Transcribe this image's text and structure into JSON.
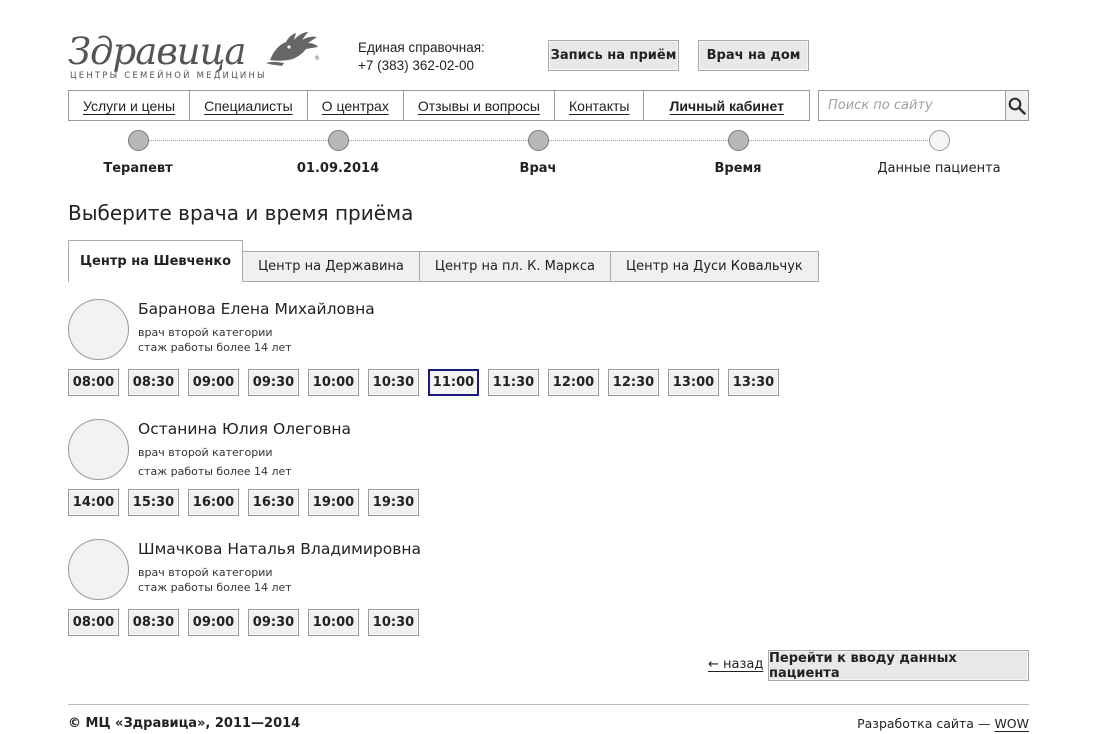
{
  "logo": {
    "word": "Здравица",
    "subtitle": "ЦЕНТРЫ СЕМЕЙНОЙ МЕДИЦИНЫ",
    "icon": "hand-bird-logo-icon"
  },
  "contact": {
    "label": "Единая справочная:",
    "phone": "+7 (383) 362-02-00"
  },
  "header_buttons": {
    "appointment": "Запись на приём",
    "home_visit": "Врач на дом"
  },
  "nav": {
    "items": [
      "Услуги и цены",
      "Специалисты",
      "О центрах",
      "Отзывы и вопросы",
      "Контакты",
      "Личный кабинет"
    ]
  },
  "search": {
    "placeholder": "Поиск по сайту",
    "icon": "search-icon"
  },
  "steps": [
    "Терапевт",
    "01.09.2014",
    "Врач",
    "Время",
    "Данные пациента"
  ],
  "page_title": "Выберите врача и время приёма",
  "tabs": [
    "Центр на Шевченко",
    "Центр на Державина",
    "Центр на пл. К. Маркса",
    "Центр на Дуси Ковальчук"
  ],
  "active_tab": "Центр на Шевченко",
  "doctors": [
    {
      "name": "Баранова Елена Михайловна",
      "category": "врач второй категории",
      "experience": "стаж работы более 14 лет",
      "slots": [
        "08:00",
        "08:30",
        "09:00",
        "09:30",
        "10:00",
        "10:30",
        "11:00",
        "11:30",
        "12:00",
        "12:30",
        "13:00",
        "13:30"
      ],
      "selected_slot": "11:00"
    },
    {
      "name": "Останина Юлия Олеговна",
      "category": "врач второй категории",
      "experience": "стаж работы более 14 лет",
      "slots": [
        "14:00",
        "15:30",
        "16:00",
        "16:30",
        "19:00",
        "19:30"
      ],
      "selected_slot": ""
    },
    {
      "name": "Шмачкова Наталья Владимировна",
      "category": "врач второй категории",
      "experience": "стаж работы более 14 лет",
      "slots": [
        "08:00",
        "08:30",
        "09:00",
        "09:30",
        "10:00",
        "10:30"
      ],
      "selected_slot": ""
    }
  ],
  "actions": {
    "back": "← назад",
    "next": "Перейти к вводу данных пациента"
  },
  "footer": {
    "copyright": "© МЦ «Здравица», 2011—2014",
    "dev_label": "Разработка сайта —",
    "dev_link": "WOW"
  },
  "colors": {
    "selected_slot_border": "#1a1a7a",
    "button_bg": "#e8e8e8",
    "step_done": "#b8b8b8"
  }
}
